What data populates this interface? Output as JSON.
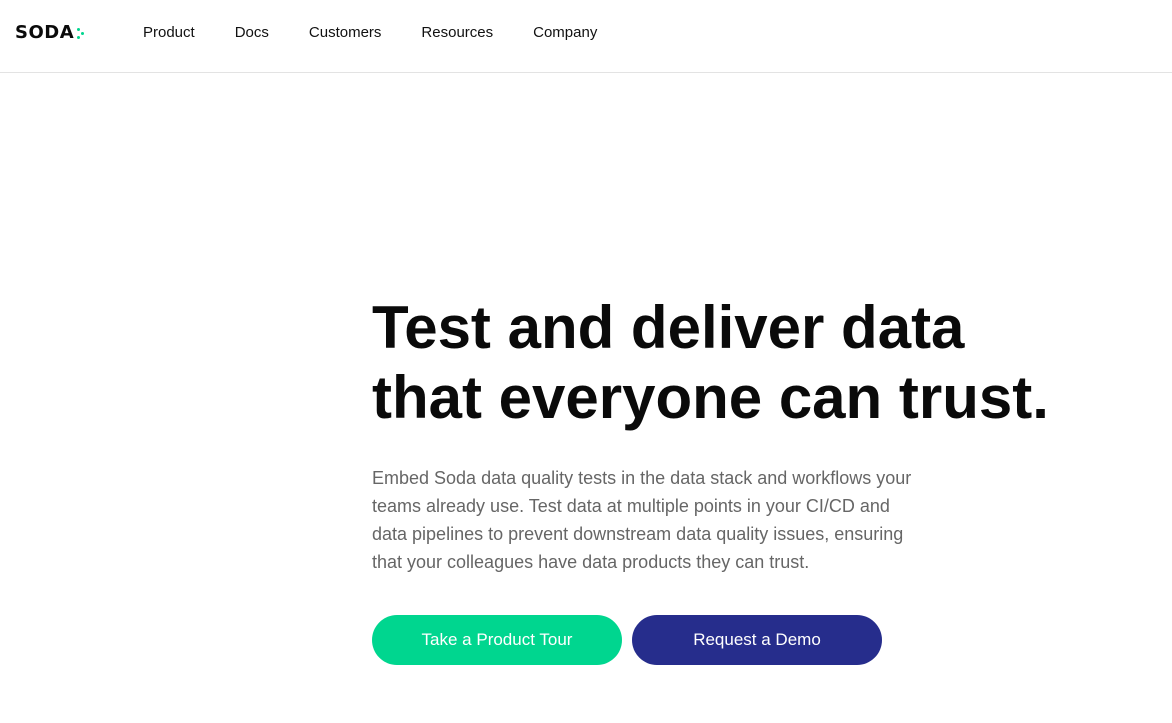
{
  "header": {
    "logo_text": "SODA",
    "nav": [
      "Product",
      "Docs",
      "Customers",
      "Resources",
      "Company"
    ]
  },
  "hero": {
    "title_line1": "Test and deliver data",
    "title_line2": "that everyone can trust.",
    "description_lines": [
      "Embed Soda data quality tests in the data stack and workflows your",
      "teams already use. Test data at multiple points in your CI/CD and",
      "data pipelines to prevent downstream data quality issues, ensuring",
      "that your colleagues have data products they can trust."
    ],
    "primary_button": "Take a Product Tour",
    "secondary_button": "Request a Demo"
  },
  "colors": {
    "accent_green": "#00d68f",
    "accent_navy": "#262d8c"
  }
}
